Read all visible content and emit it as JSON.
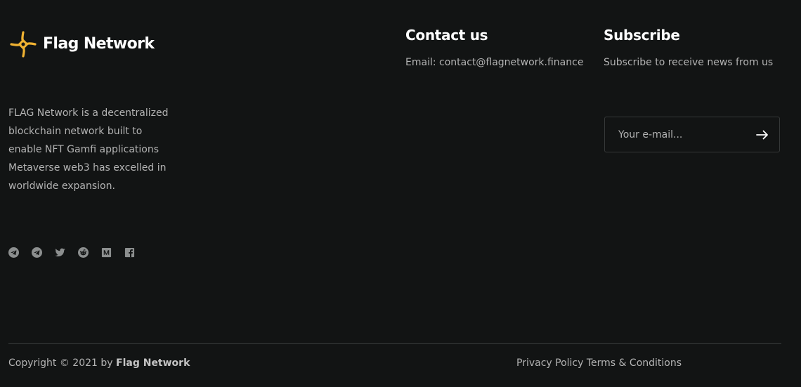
{
  "brand": {
    "name": "Flag Network",
    "logo_icon": "flag-network-logo-icon",
    "accent_color": "#f0b232"
  },
  "about": {
    "text": "FLAG Network is a decentralized blockchain network built to enable NFT Gamfi applications Metaverse web3 has excelled in worldwide expansion."
  },
  "socials": [
    {
      "name": "telegram",
      "icon": "telegram-icon"
    },
    {
      "name": "telegram",
      "icon": "telegram-icon"
    },
    {
      "name": "twitter",
      "icon": "twitter-icon"
    },
    {
      "name": "reddit",
      "icon": "reddit-icon"
    },
    {
      "name": "medium",
      "icon": "medium-icon"
    },
    {
      "name": "facebook",
      "icon": "facebook-icon"
    }
  ],
  "contact": {
    "title": "Contact us",
    "email_line": "Email: contact@flagnetwork.finance"
  },
  "subscribe": {
    "title": "Subscribe",
    "description": "Subscribe to receive news from us",
    "email_value": "",
    "email_placeholder": "Your e-mail...",
    "submit_icon": "arrow-right-icon"
  },
  "footer": {
    "copyright_prefix": "Copyright © 2021 by ",
    "copyright_brand": "Flag Network",
    "privacy_label": "Privacy Policy",
    "terms_label": "Terms & Conditions"
  },
  "colors": {
    "background": "#121414",
    "text_muted": "#b3b3b3",
    "heading": "#ffffff",
    "divider": "#3a3d3d",
    "input_border": "#353838",
    "icon_gray": "#8c8f8f"
  }
}
